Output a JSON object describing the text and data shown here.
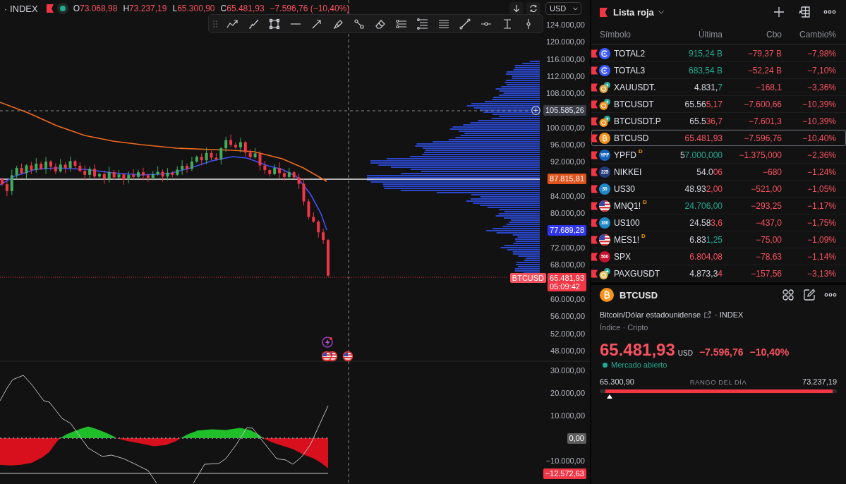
{
  "chart_header": {
    "title": "· INDEX",
    "market_open": true,
    "falling": true,
    "ohlc": [
      {
        "label": "O",
        "value": "73.068,98"
      },
      {
        "label": "H",
        "value": "73.237,19"
      },
      {
        "label": "L",
        "value": "65.300,90"
      },
      {
        "label": "C",
        "value": "65.481,93"
      }
    ],
    "change": "−7.596,76 (−10,40%)",
    "currency": "USD"
  },
  "price_axis": {
    "marks": [
      {
        "kind": "tick",
        "text": "124.000,00"
      },
      {
        "kind": "tick",
        "text": "120.000,00"
      },
      {
        "kind": "tick",
        "text": "116.000,00"
      },
      {
        "kind": "tick",
        "text": "112.000,00"
      },
      {
        "kind": "tick",
        "text": "108.000,00"
      },
      {
        "kind": "crosshair-tag",
        "text": "105.585,26"
      },
      {
        "kind": "tick",
        "text": "100.000,00"
      },
      {
        "kind": "tick",
        "text": "96.000,00"
      },
      {
        "kind": "tick",
        "text": "92.000,00"
      },
      {
        "kind": "level-tag",
        "text": "87.815,81"
      },
      {
        "kind": "tick",
        "text": "84.000,00"
      },
      {
        "kind": "tick",
        "text": "80.000,00"
      },
      {
        "kind": "average-tag",
        "text": "77.689,28"
      },
      {
        "kind": "tick",
        "text": "72.000,00"
      },
      {
        "kind": "tick",
        "text": "68.000,00"
      },
      {
        "kind": "price-tag",
        "symbol": "BTCUSD",
        "text": "65.481,93",
        "countdown": "05:09:42"
      },
      {
        "kind": "tick",
        "text": "60.000,00"
      },
      {
        "kind": "tick",
        "text": "56.000,00"
      },
      {
        "kind": "tick",
        "text": "52.000,00"
      },
      {
        "kind": "tick",
        "text": "48.000,00"
      }
    ]
  },
  "oscillator_axis": {
    "marks": [
      {
        "kind": "tick",
        "text": "30.000,00"
      },
      {
        "kind": "tick",
        "text": "20.000,00"
      },
      {
        "kind": "tick",
        "text": "10.000,00"
      },
      {
        "kind": "zero-tag",
        "text": "0,00"
      },
      {
        "kind": "tick",
        "text": "−10.000,00"
      },
      {
        "kind": "value-tag",
        "text": "−12.572,63"
      }
    ]
  },
  "watchlist": {
    "title": "Lista roja",
    "columns": [
      "Símbolo",
      "Última",
      "Cbo",
      "Cambio%"
    ],
    "rows": [
      {
        "symbol": "TOTAL2",
        "logo": {
          "kind": "ring",
          "color": "#3d5afe"
        },
        "last_tick": "915,24 B",
        "tick_up": true,
        "change": "−79,37 B",
        "change_pct": "−7,98%",
        "negative": true,
        "selected": false
      },
      {
        "symbol": "TOTAL3",
        "logo": {
          "kind": "ring",
          "color": "#3d5afe"
        },
        "last_tick": "683,54 B",
        "tick_up": true,
        "change": "−52,24 B",
        "change_pct": "−7,10%",
        "negative": true,
        "selected": false
      },
      {
        "symbol": "XAUUSDT.",
        "logo": {
          "kind": "coin-pair",
          "color": "#d9a441"
        },
        "last_prefix": "4.831,",
        "last_tick": "7",
        "tick_up": true,
        "change": "−168,1",
        "change_pct": "−3,36%",
        "negative": true,
        "selected": false
      },
      {
        "symbol": "BTCUSDT",
        "logo": {
          "kind": "coin-pair",
          "color": "#f7931a"
        },
        "last_prefix": "65.56",
        "last_tick": "5,17",
        "tick_up": false,
        "change": "−7.600,66",
        "change_pct": "−10,39%",
        "negative": true,
        "selected": false
      },
      {
        "symbol": "BTCUSDT.P",
        "logo": {
          "kind": "coin-pair",
          "color": "#f7931a"
        },
        "last_prefix": "65.5",
        "last_tick": "36,7",
        "tick_up": false,
        "change": "−7.601,3",
        "change_pct": "−10,39%",
        "negative": true,
        "selected": false
      },
      {
        "symbol": "BTCUSD",
        "logo": {
          "kind": "bitcoin"
        },
        "last_tick": "65.481,93",
        "tick_up": false,
        "change": "−7.596,76",
        "change_pct": "−10,40%",
        "negative": true,
        "selected": true
      },
      {
        "symbol": "YPFD",
        "badge": "D",
        "logo": {
          "kind": "badge",
          "text": "YPF",
          "color": "#1565c0"
        },
        "last_prefix": "5",
        "last_tick": "7.000,000",
        "tick_up": true,
        "change": "−1.375,000",
        "change_pct": "−2,36%",
        "negative": true,
        "selected": false
      },
      {
        "symbol": "NIKKEI",
        "logo": {
          "kind": "badge",
          "text": "225",
          "color": "#233c7d"
        },
        "last_prefix": "54.0",
        "last_tick": "06",
        "tick_up": false,
        "change": "−680",
        "change_pct": "−1,24%",
        "negative": true,
        "selected": false
      },
      {
        "symbol": "US30",
        "logo": {
          "kind": "badge",
          "text": "30",
          "color": "#1e88c8"
        },
        "last_prefix": "48.93",
        "last_tick": "2,00",
        "tick_up": false,
        "change": "−521,00",
        "change_pct": "−1,05%",
        "negative": true,
        "selected": false
      },
      {
        "symbol": "MNQ1!",
        "badge": "D",
        "logo": {
          "kind": "flag"
        },
        "last_tick": "24.706,00",
        "tick_up": true,
        "change": "−293,25",
        "change_pct": "−1,17%",
        "negative": true,
        "selected": false
      },
      {
        "symbol": "US100",
        "logo": {
          "kind": "badge",
          "text": "100",
          "color": "#1e88c8"
        },
        "last_prefix": "24.58",
        "last_tick": "3,6",
        "tick_up": false,
        "change": "−437,0",
        "change_pct": "−1,75%",
        "negative": true,
        "selected": false
      },
      {
        "symbol": "MES1!",
        "badge": "D",
        "logo": {
          "kind": "flag"
        },
        "last_prefix": "6.83",
        "last_tick": "1,25",
        "tick_up": true,
        "change": "−75,00",
        "change_pct": "−1,09%",
        "negative": true,
        "selected": false
      },
      {
        "symbol": "SPX",
        "logo": {
          "kind": "badge",
          "text": "500",
          "color": "#c8102e"
        },
        "last_tick": "6.804,08",
        "tick_up": false,
        "change": "−78,63",
        "change_pct": "−1,14%",
        "negative": true,
        "selected": false
      },
      {
        "symbol": "PAXGUSDT",
        "logo": {
          "kind": "coin-pair",
          "color": "#e8c35a"
        },
        "last_prefix": "4.873,3",
        "last_tick": "4",
        "tick_up": false,
        "change": "−157,56",
        "change_pct": "−3,13%",
        "negative": true,
        "selected": false
      }
    ]
  },
  "details": {
    "symbol": "BTCUSD",
    "logo": {
      "kind": "bitcoin"
    },
    "name": "Bitcoin/Dólar estadounidense",
    "exchange": "· INDEX",
    "category": "Índice · Cripto",
    "price": "65.481,93",
    "currency": "USD",
    "change": "−7.596,76",
    "change_pct": "−10,40%",
    "falling": true,
    "market_open": true,
    "market_status": "Mercado abierto",
    "range": {
      "low": "65.300,90",
      "title": "RANGO DEL DÍA",
      "high": "73.237,19",
      "level": 0.02
    }
  }
}
